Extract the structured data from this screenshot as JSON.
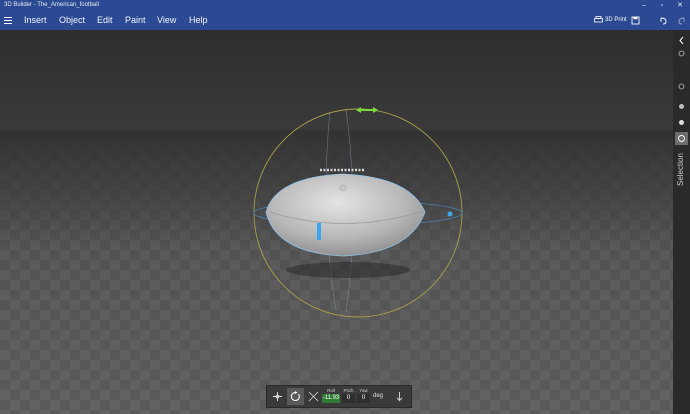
{
  "titlebar": {
    "title": "3D Builder - The_American_football",
    "buttons": {
      "minimize": "–",
      "maximize": "▫",
      "close": "✕"
    }
  },
  "menu": {
    "items": [
      "Insert",
      "Object",
      "Edit",
      "Paint",
      "View",
      "Help"
    ],
    "print_label": "3D Print"
  },
  "side_panel": {
    "label": "Selection"
  },
  "rotate_toolbar": {
    "roll_label": "Roll",
    "roll_value": "-11.93",
    "pitch_label": "Pitch",
    "pitch_value": "0",
    "yaw_label": "Yaw",
    "yaw_value": "0",
    "unit": "deg"
  },
  "colors": {
    "accent": "#2b4a93",
    "gizmo_green": "#7ddc3a",
    "gizmo_blue": "#3aa8e8",
    "gizmo_ring": "#a9a04a"
  }
}
